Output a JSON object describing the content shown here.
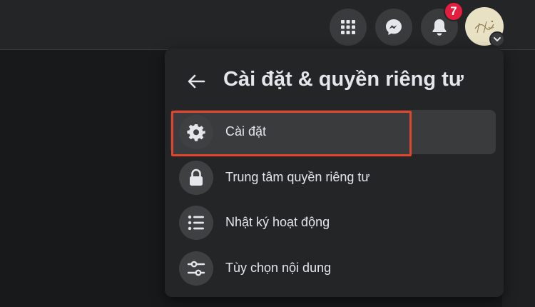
{
  "topbar": {
    "icons": [
      "apps-grid-icon",
      "messenger-icon",
      "bell-icon"
    ],
    "notification_count": "7",
    "avatar_text": "Hai"
  },
  "menu": {
    "title": "Cài đặt & quyền riêng tư",
    "items": [
      {
        "label": "Cài đặt",
        "icon": "gear-icon"
      },
      {
        "label": "Trung tâm quyền riêng tư",
        "icon": "lock-icon"
      },
      {
        "label": "Nhật ký hoạt động",
        "icon": "list-icon"
      },
      {
        "label": "Tùy chọn nội dung",
        "icon": "sliders-icon"
      }
    ]
  },
  "colors": {
    "background": "#18191a",
    "surface": "#242526",
    "hover": "#3a3b3c",
    "text": "#e4e6eb",
    "badge": "#e41e3f",
    "highlight": "#e0452d"
  }
}
